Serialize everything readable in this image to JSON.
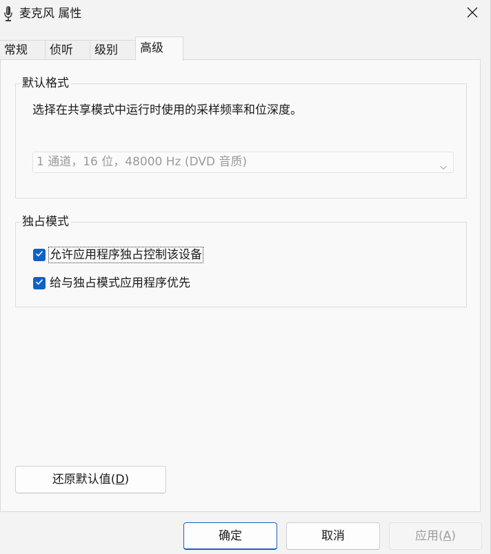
{
  "window": {
    "title": "麦克风 属性"
  },
  "tabs": [
    {
      "label": "常规"
    },
    {
      "label": "侦听"
    },
    {
      "label": "级别"
    },
    {
      "label": "高级"
    }
  ],
  "active_tab": "高级",
  "default_format": {
    "legend": "默认格式",
    "description": "选择在共享模式中运行时使用的采样频率和位深度。",
    "selected_value": "1 通道，16 位，48000 Hz (DVD 音质)"
  },
  "exclusive_mode": {
    "legend": "独占模式",
    "options": [
      {
        "label": "允许应用程序独占控制该设备",
        "checked": true
      },
      {
        "label": "给与独占模式应用程序优先",
        "checked": true
      }
    ]
  },
  "restore_button": {
    "label_prefix": "还原默认值(",
    "mnemonic": "D",
    "label_suffix": ")"
  },
  "footer": {
    "ok_label": "确定",
    "cancel_label": "取消",
    "apply_prefix": "应用(",
    "apply_mnemonic": "A",
    "apply_suffix": ")"
  },
  "colors": {
    "accent": "#0f61c4",
    "disabled_text": "#9a9a9a"
  },
  "icons": {
    "title": "microphone-icon",
    "close": "close-icon",
    "dropdown": "chevron-down-icon",
    "check": "checkmark-icon"
  }
}
